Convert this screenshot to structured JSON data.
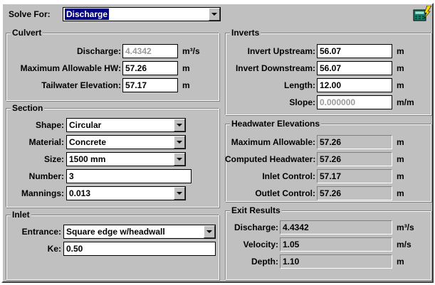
{
  "header": {
    "solve_for_label": "Solve For:",
    "solve_for_value": "Discharge",
    "app_icon": "calculator-lightning-icon"
  },
  "culvert": {
    "title": "Culvert",
    "discharge_label": "Discharge:",
    "discharge_value": "4.4342",
    "discharge_unit": "m³/s",
    "max_hw_label": "Maximum Allowable HW:",
    "max_hw_value": "57.26",
    "max_hw_unit": "m",
    "tailwater_label": "Tailwater Elevation:",
    "tailwater_value": "57.17",
    "tailwater_unit": "m"
  },
  "section": {
    "title": "Section",
    "shape_label": "Shape:",
    "shape_value": "Circular",
    "material_label": "Material:",
    "material_value": "Concrete",
    "size_label": "Size:",
    "size_value": "1500 mm",
    "number_label": "Number:",
    "number_value": "3",
    "mannings_label": "Mannings:",
    "mannings_value": "0.013"
  },
  "inlet": {
    "title": "Inlet",
    "entrance_label": "Entrance:",
    "entrance_value": "Square edge w/headwall",
    "ke_label": "Ke:",
    "ke_value": "0.50"
  },
  "inverts": {
    "title": "Inverts",
    "upstream_label": "Invert Upstream:",
    "upstream_value": "56.07",
    "upstream_unit": "m",
    "downstream_label": "Invert Downstream:",
    "downstream_value": "56.07",
    "downstream_unit": "m",
    "length_label": "Length:",
    "length_value": "12.00",
    "length_unit": "m",
    "slope_label": "Slope:",
    "slope_value": "0.000000",
    "slope_unit": "m/m"
  },
  "headwater": {
    "title": "Headwater Elevations",
    "max_allowable_label": "Maximum Allowable:",
    "max_allowable_value": "57.26",
    "max_allowable_unit": "m",
    "computed_label": "Computed Headwater:",
    "computed_value": "57.26",
    "computed_unit": "m",
    "inlet_label": "Inlet Control:",
    "inlet_value": "57.17",
    "inlet_unit": "m",
    "outlet_label": "Outlet Control:",
    "outlet_value": "57.26",
    "outlet_unit": "m"
  },
  "exit": {
    "title": "Exit Results",
    "discharge_label": "Discharge:",
    "discharge_value": "4.4342",
    "discharge_unit": "m³/s",
    "velocity_label": "Velocity:",
    "velocity_value": "1.05",
    "velocity_unit": "m/s",
    "depth_label": "Depth:",
    "depth_value": "1.10",
    "depth_unit": "m"
  }
}
